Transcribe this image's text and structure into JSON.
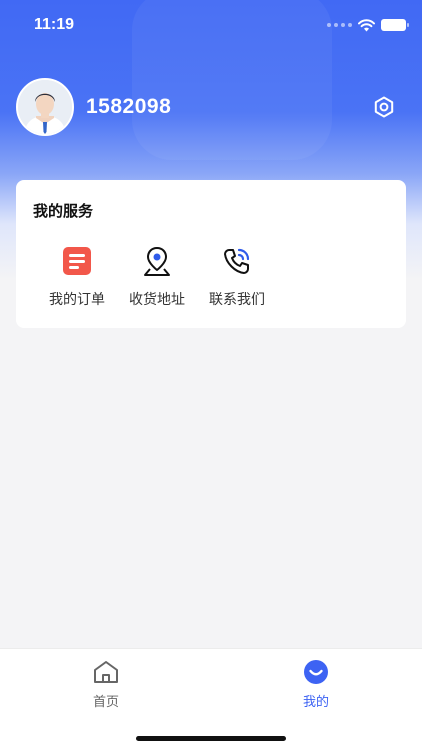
{
  "status_bar": {
    "time": "11:19"
  },
  "profile": {
    "username": "1582098"
  },
  "services": {
    "title": "我的服务",
    "items": [
      {
        "label": "我的订单",
        "icon": "order-list-icon",
        "color": "#f2574a"
      },
      {
        "label": "收货地址",
        "icon": "location-pin-icon",
        "color": "#2f5bea"
      },
      {
        "label": "联系我们",
        "icon": "phone-call-icon",
        "color": "#2f5bea"
      }
    ]
  },
  "tabbar": {
    "items": [
      {
        "label": "首页",
        "icon": "home-icon",
        "active": false
      },
      {
        "label": "我的",
        "icon": "smile-profile-icon",
        "active": true
      }
    ],
    "active_color": "#3d63f3",
    "inactive_color": "#666666"
  },
  "colors": {
    "brand": "#4169f4",
    "background": "#f4f4f6"
  }
}
